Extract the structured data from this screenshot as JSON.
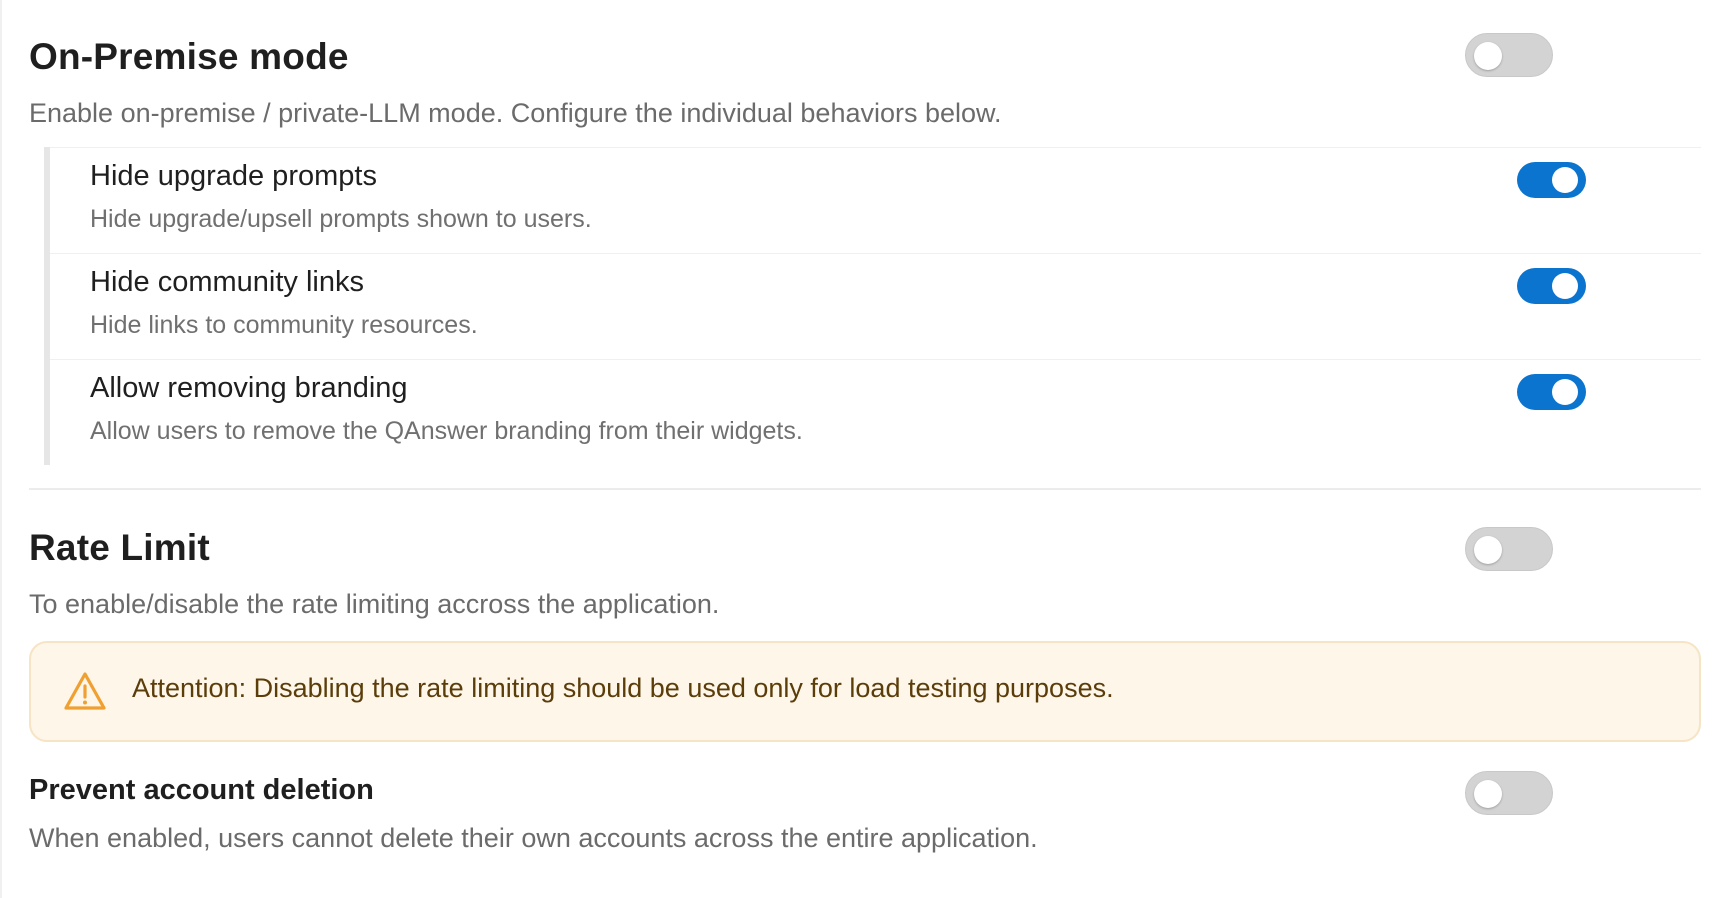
{
  "on_premise": {
    "title": "On-Premise mode",
    "description": "Enable on-premise / private-LLM mode. Configure the individual behaviors below.",
    "enabled": false,
    "options": [
      {
        "title": "Hide upgrade prompts",
        "description": "Hide upgrade/upsell prompts shown to users.",
        "enabled": true
      },
      {
        "title": "Hide community links",
        "description": "Hide links to community resources.",
        "enabled": true
      },
      {
        "title": "Allow removing branding",
        "description": "Allow users to remove the QAnswer branding from their widgets.",
        "enabled": true
      }
    ]
  },
  "rate_limit": {
    "title": "Rate Limit",
    "description": "To enable/disable the rate limiting accross the application.",
    "enabled": false,
    "alert": {
      "icon": "warning-triangle-icon",
      "text": "Attention: Disabling the rate limiting should be used only for load testing purposes."
    }
  },
  "prevent_deletion": {
    "title": "Prevent account deletion",
    "description": "When enabled, users cannot delete their own accounts across the entire application.",
    "enabled": false
  },
  "colors": {
    "toggle_on": "#0b74cf",
    "toggle_off": "#d3d3d3",
    "alert_bg": "#fdf6e9",
    "alert_icon": "#f0a030"
  }
}
